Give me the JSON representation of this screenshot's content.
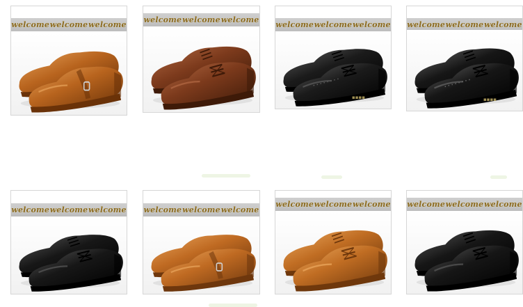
{
  "banner_text": "welcome",
  "products": [
    {
      "id": "shoe-1",
      "color": "tan",
      "style": "monk-strap",
      "upper": "#b8641e",
      "dark": "#6a3208",
      "light": "#e7a25a"
    },
    {
      "id": "shoe-2",
      "color": "brown",
      "style": "lace-up",
      "upper": "#7c3a1c",
      "dark": "#3e1a08",
      "light": "#b36a44"
    },
    {
      "id": "shoe-3",
      "color": "black",
      "style": "brogue",
      "upper": "#1b1b1b",
      "dark": "#000000",
      "light": "#5e5e5e"
    },
    {
      "id": "shoe-4",
      "color": "black",
      "style": "wingtip",
      "upper": "#161616",
      "dark": "#000000",
      "light": "#666666"
    },
    {
      "id": "shoe-5",
      "color": "black",
      "style": "lace-up",
      "upper": "#171717",
      "dark": "#000000",
      "light": "#5a5a5a"
    },
    {
      "id": "shoe-6",
      "color": "tan",
      "style": "monk-strap",
      "upper": "#bf6a22",
      "dark": "#6e370d",
      "light": "#eaa65e"
    },
    {
      "id": "shoe-7",
      "color": "tan",
      "style": "lace-up",
      "upper": "#c06d23",
      "dark": "#6f380c",
      "light": "#ecaa60"
    },
    {
      "id": "shoe-8",
      "color": "black",
      "style": "lace-up",
      "upper": "#161616",
      "dark": "#000000",
      "light": "#5a5a5a"
    }
  ],
  "colors": {
    "banner_text": "#8a6a22",
    "banner_bg": "#c6c6c6",
    "border": "#d6d6d6"
  }
}
